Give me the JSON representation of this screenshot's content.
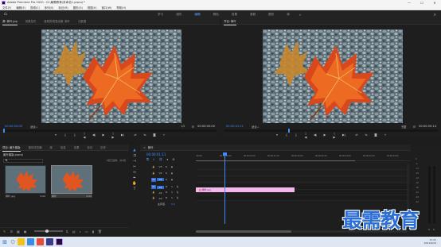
{
  "window": {
    "title": "Adobe Premiere Pro 2020 - D:\\最需教育\\未命名1.prproj *",
    "minimize": "—",
    "maximize": "☐",
    "close": "✕"
  },
  "menu": [
    "文件(F)",
    "编辑(E)",
    "剪辑(C)",
    "序列(S)",
    "标记(M)",
    "图形(G)",
    "视图(V)",
    "窗口(W)",
    "帮助(H)"
  ],
  "workspaces": {
    "tabs": [
      "学习",
      "组件",
      "编辑",
      "颜色",
      "效果",
      "音频",
      "图形",
      "库"
    ],
    "active": "编辑",
    "more": "»"
  },
  "source_monitor": {
    "tabs": [
      "源: 枫叶.jpg",
      "效果控件",
      "音频剪辑混合器: 枫叶",
      "元数据"
    ],
    "timecode": "00:00:00:00",
    "fit": "适合",
    "resolution": "1/2",
    "duration": "00:00:05:00"
  },
  "program_monitor": {
    "tab": "节目: 枫叶",
    "timecode": "00:00:01:11",
    "fit": "适合",
    "resolution": "完整",
    "duration": "00:00:05:14"
  },
  "transport": {
    "buttons": [
      "▾",
      "{",
      "}",
      "|◀",
      "◀|",
      "▶",
      "|▶",
      "▶|",
      "⇄",
      "⇆",
      "◙"
    ],
    "add": "+"
  },
  "project_panel": {
    "tabs": [
      "项目: 最升模版",
      "媒体浏览器",
      "库",
      "信息",
      "效果",
      "标记",
      "历史"
    ],
    "project_name": "最升模版.prproj",
    "search_placeholder": "🔍",
    "item_count": "1项已选择，共2项",
    "items": [
      {
        "name": "枫叶.jpg",
        "duration": "5:00",
        "selected": false
      },
      {
        "name": "枫叶",
        "duration": "5:00",
        "selected": true
      }
    ]
  },
  "timeline": {
    "tab": "枫叶",
    "timecode": "00:00:01:11",
    "ruler_ticks": [
      ":00:00",
      "00:00:00:10",
      "00:00:01:00",
      "00:00:01:10",
      "00:00:02:00",
      "00:00:02:10",
      "00:00:03:00",
      "00:00:03:10",
      "00:00:04:00"
    ],
    "video_tracks": [
      "V3",
      "V2",
      "V1"
    ],
    "audio_tracks": [
      "A1",
      "A2",
      "A3"
    ],
    "master": {
      "label": "主声道",
      "value": "0.0"
    },
    "clip": {
      "label": "枫叶.jpg",
      "track": "V1"
    }
  },
  "meters": {
    "scale": [
      "0",
      "-6",
      "-12",
      "-18",
      "-24",
      "-30",
      "-36",
      "-42",
      "-48",
      "-54"
    ],
    "labels": [
      "S",
      "S"
    ]
  },
  "watermark": "最需教育",
  "taskbar": {
    "clock_time": "17:21",
    "clock_date": "2021/9/24"
  },
  "colors": {
    "accent": "#3f8cff",
    "clip": "#f2b8ec",
    "watermark": "#2b6fd6"
  }
}
